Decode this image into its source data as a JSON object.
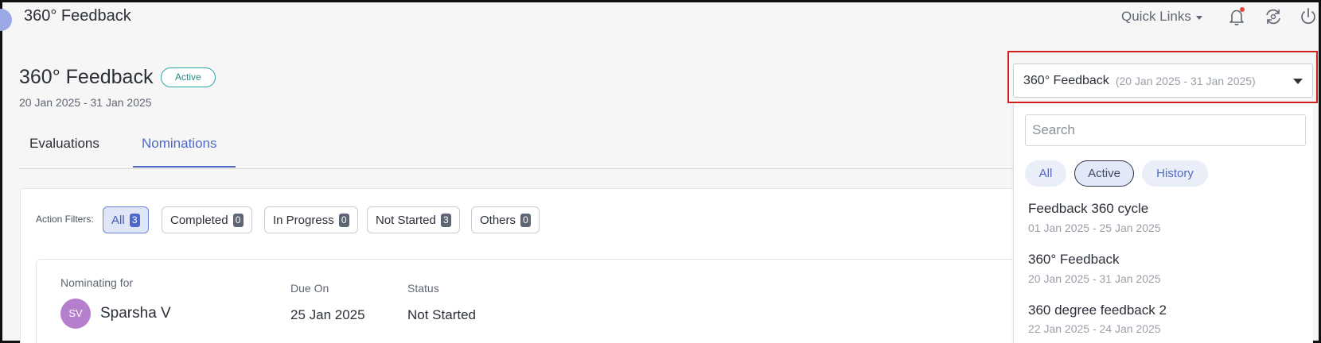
{
  "app": {
    "title": "360° Feedback",
    "quick_links": "Quick Links"
  },
  "header": {
    "title": "360° Feedback",
    "status": "Active",
    "date_range": "20 Jan 2025 - 31 Jan 2025"
  },
  "tabs": [
    {
      "label": "Evaluations",
      "active": false
    },
    {
      "label": "Nominations",
      "active": true
    }
  ],
  "filters": {
    "label": "Action Filters:",
    "chips": [
      {
        "label": "All",
        "count": "3",
        "selected": true
      },
      {
        "label": "Completed",
        "count": "0",
        "selected": false
      },
      {
        "label": "In Progress",
        "count": "0",
        "selected": false
      },
      {
        "label": "Not Started",
        "count": "3",
        "selected": false
      },
      {
        "label": "Others",
        "count": "0",
        "selected": false
      }
    ]
  },
  "nomination": {
    "nominating_for_label": "Nominating for",
    "due_on_label": "Due On",
    "status_label": "Status",
    "avatar_initials": "SV",
    "person_name": "Sparsha V",
    "due_on": "25 Jan 2025",
    "status": "Not Started"
  },
  "cycle_select": {
    "name": "360° Feedback",
    "dates": "(20 Jan 2025 - 31 Jan 2025)"
  },
  "dropdown": {
    "search_placeholder": "Search",
    "segments": [
      {
        "label": "All",
        "selected": false
      },
      {
        "label": "Active",
        "selected": true
      },
      {
        "label": "History",
        "selected": false
      }
    ],
    "items": [
      {
        "name": "Feedback 360 cycle",
        "dates": "01 Jan 2025 - 25 Jan 2025"
      },
      {
        "name": "360° Feedback",
        "dates": "20 Jan 2025 - 31 Jan 2025"
      },
      {
        "name": "360 degree feedback 2",
        "dates": "22 Jan 2025 - 24 Jan 2025"
      }
    ]
  },
  "colors": {
    "accent": "#4f6ac6",
    "active_badge": "#2ea7a0",
    "highlight_frame": "#d0201d",
    "avatar": "#b57fce",
    "notification_dot": "#e8443a"
  },
  "icons": [
    "app-logo-icon",
    "chevron-down-icon",
    "bell-icon",
    "sync-icon",
    "power-icon",
    "dropdown-caret-icon"
  ]
}
